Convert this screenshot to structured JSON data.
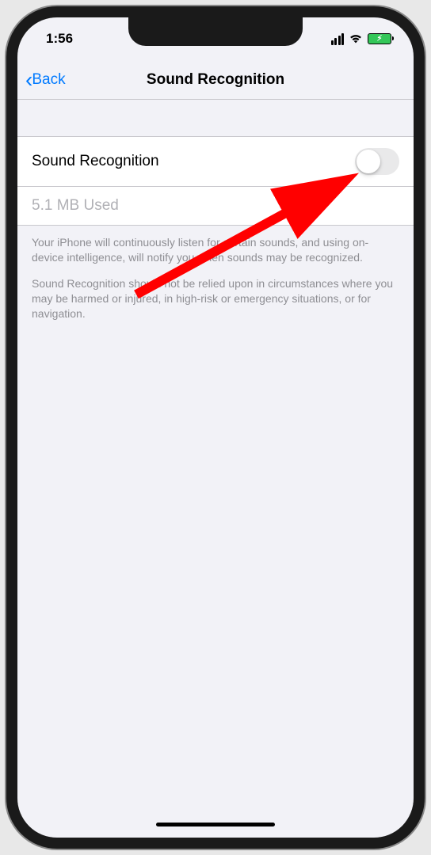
{
  "statusBar": {
    "time": "1:56"
  },
  "nav": {
    "back": "Back",
    "title": "Sound Recognition"
  },
  "main": {
    "toggleLabel": "Sound Recognition",
    "usage": "5.1 MB Used",
    "note1": "Your iPhone will continuously listen for certain sounds, and using on-device intelligence, will notify you when sounds may be recognized.",
    "note2": "Sound Recognition should not be relied upon in circumstances where you may be harmed or injured, in high-risk or emergency situations, or for navigation."
  }
}
